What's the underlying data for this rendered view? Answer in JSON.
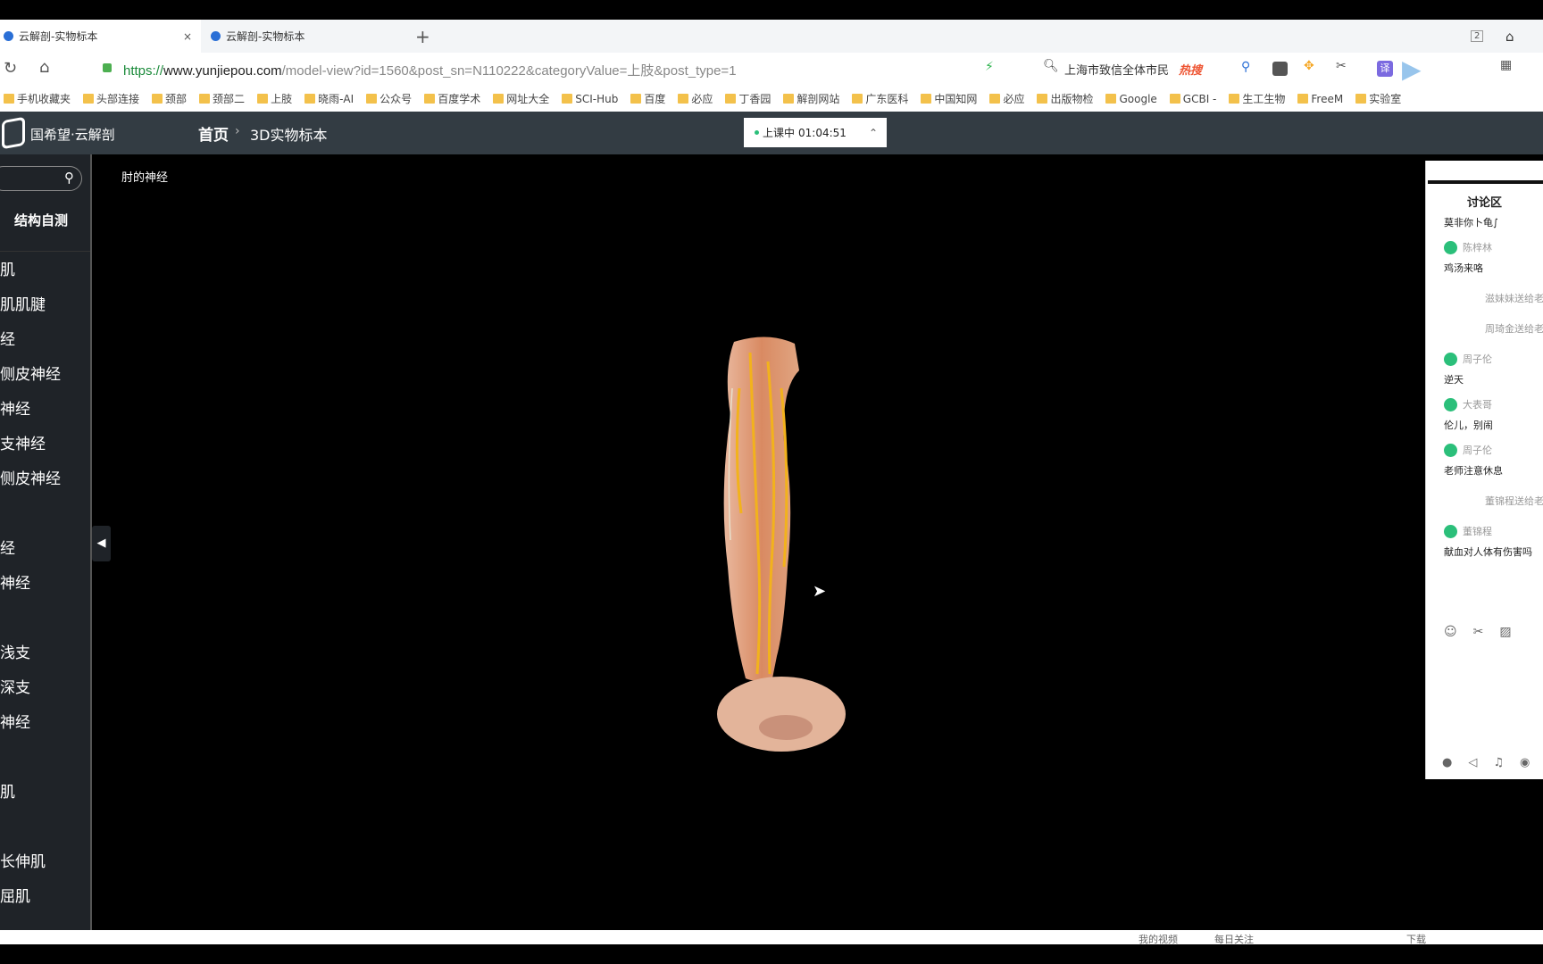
{
  "browser": {
    "tabs": [
      {
        "title": "云解剖-实物标本",
        "close": "×"
      },
      {
        "title": "云解剖-实物标本"
      }
    ],
    "new_tab": "+",
    "tab_count": "2",
    "url_scheme": "https://",
    "url_host": "www.yunjiepou.com",
    "url_path": "/model-view?id=1560&post_sn=N110222&categoryValue=上肢&post_type=1",
    "search_hint": "上海市致信全体市民",
    "hot_label": "热搜",
    "bookmarks": [
      "手机收藏夹",
      "头部连接",
      "颈部",
      "颈部二",
      "上肢",
      "晓雨-AI",
      "公众号",
      "百度学术",
      "网址大全",
      "SCI-Hub",
      "百度",
      "必应",
      "丁香园",
      "解剖网站",
      "广东医科",
      "中国知网",
      "必应",
      "出版物检",
      "Google",
      "GCBI -",
      "生工生物",
      "FreeM",
      "实验室"
    ]
  },
  "app": {
    "logo_text": "国希望·云解剖",
    "breadcrumb": {
      "home": "首页",
      "sep": "›",
      "current": "3D实物标本"
    },
    "session": {
      "status": "上课中",
      "timer": "01:04:51"
    },
    "model_title": "肘的神经",
    "sidebar": {
      "self_test": "结构自测",
      "items": [
        "肌",
        "肌肌腱",
        "经",
        "侧皮神经",
        "神经",
        "支神经",
        "侧皮神经",
        "经",
        "神经",
        "浅支",
        "深支",
        "神经",
        "肌",
        "长伸肌",
        "屈肌"
      ]
    }
  },
  "chat": {
    "title": "讨论区",
    "top_msg": "莫非你卜龟∫",
    "messages": [
      {
        "type": "msg",
        "user": "陈梓林",
        "text": "鸡汤来咯"
      },
      {
        "type": "gift",
        "text": "滋妹妹送给老"
      },
      {
        "type": "gift",
        "text": "周琦金送给老"
      },
      {
        "type": "msg",
        "user": "周子伦",
        "text": "逆天"
      },
      {
        "type": "msg",
        "user": "大表哥",
        "text": "伦儿，别闹"
      },
      {
        "type": "msg",
        "user": "周子伦",
        "text": "老师注意休息"
      },
      {
        "type": "gift",
        "text": "董锦程送给老"
      },
      {
        "type": "msg",
        "user": "董锦程",
        "text": "献血对人体有伤害吗"
      }
    ]
  },
  "status_bar": {
    "items": [
      "我的视频",
      "每日关注",
      "下载"
    ]
  }
}
